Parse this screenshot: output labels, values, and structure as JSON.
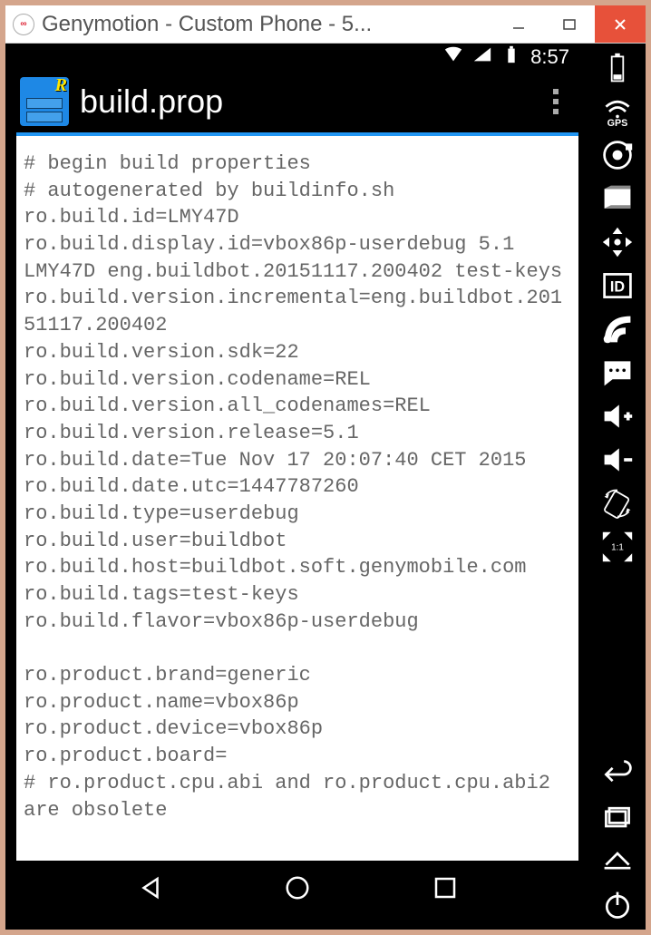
{
  "window": {
    "title": "Genymotion - Custom Phone - 5..."
  },
  "status": {
    "time": "8:57"
  },
  "app": {
    "title": "build.prop"
  },
  "file_content": "# begin build properties\n# autogenerated by buildinfo.sh\nro.build.id=LMY47D\nro.build.display.id=vbox86p-userdebug 5.1 LMY47D eng.buildbot.20151117.200402 test-keys\nro.build.version.incremental=eng.buildbot.20151117.200402\nro.build.version.sdk=22\nro.build.version.codename=REL\nro.build.version.all_codenames=REL\nro.build.version.release=5.1\nro.build.date=Tue Nov 17 20:07:40 CET 2015\nro.build.date.utc=1447787260\nro.build.type=userdebug\nro.build.user=buildbot\nro.build.host=buildbot.soft.genymobile.com\nro.build.tags=test-keys\nro.build.flavor=vbox86p-userdebug\n\nro.product.brand=generic\nro.product.name=vbox86p\nro.product.device=vbox86p\nro.product.board=\n# ro.product.cpu.abi and ro.product.cpu.abi2 are obsolete",
  "sidebar": {
    "gps_label": "GPS",
    "id_label": "ID",
    "scale_label": "1:1"
  }
}
